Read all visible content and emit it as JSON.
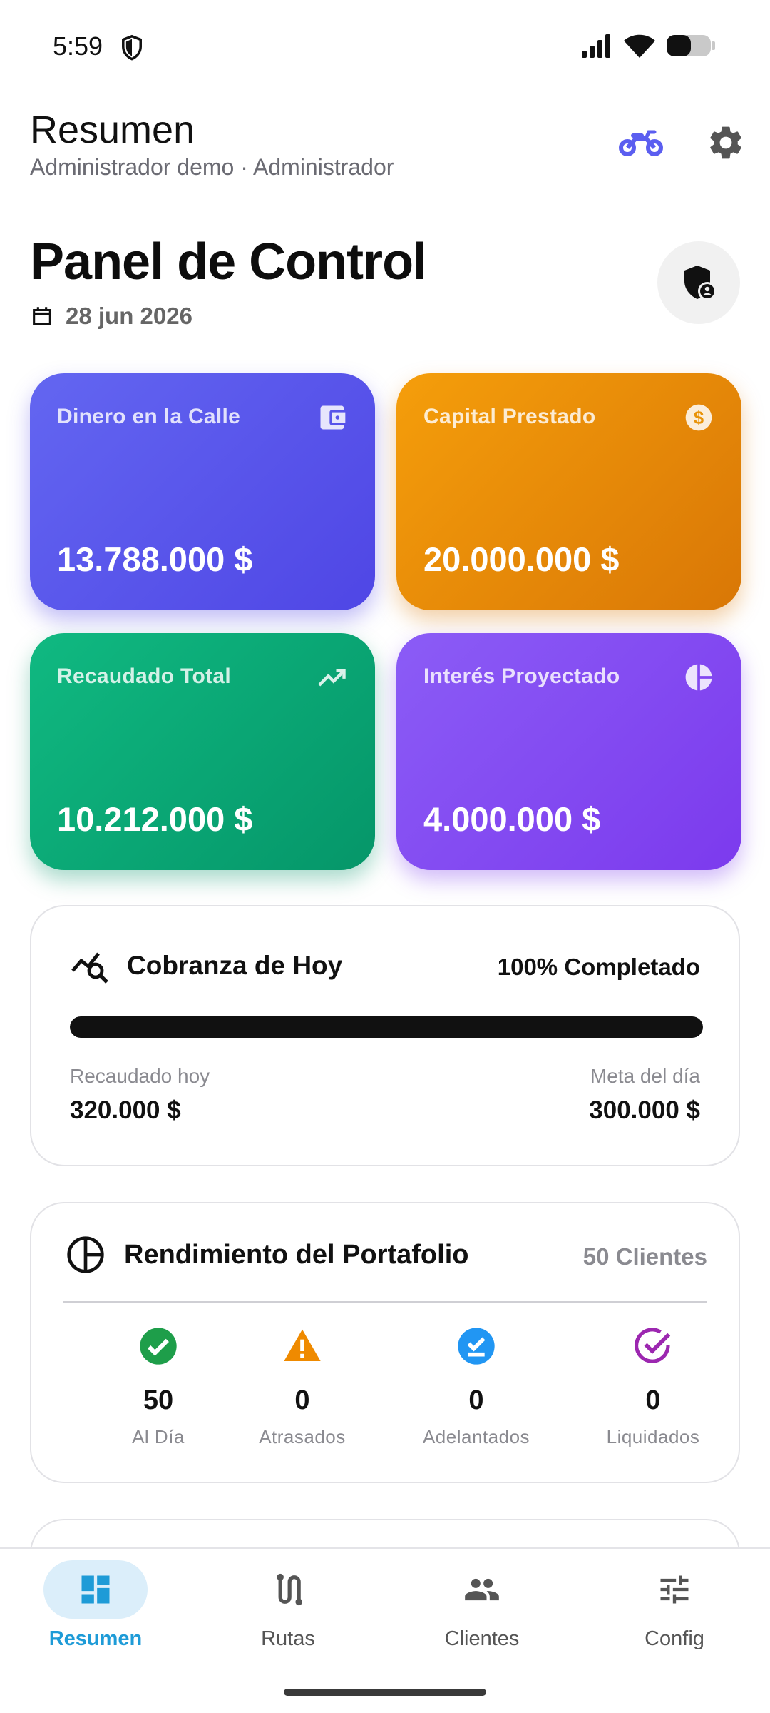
{
  "status_bar": {
    "time": "5:59"
  },
  "header": {
    "title": "Resumen",
    "subtitle": "Administrador demo · Administrador"
  },
  "panel": {
    "title": "Panel de Control",
    "date": "28 jun 2026"
  },
  "stats": [
    {
      "label": "Dinero en la Calle",
      "value": "13.788.000 $",
      "icon": "wallet-icon",
      "color": "#5b5ef0"
    },
    {
      "label": "Capital Prestado",
      "value": "20.000.000 $",
      "icon": "dollar-icon",
      "color": "#f08c08"
    },
    {
      "label": "Recaudado Total",
      "value": "10.212.000 $",
      "icon": "trending-up-icon",
      "color": "#10b07a"
    },
    {
      "label": "Interés Proyectado",
      "value": "4.000.000 $",
      "icon": "pie-chart-icon",
      "color": "#8350f2"
    }
  ],
  "cobranza": {
    "title": "Cobranza de Hoy",
    "completed_text": "100% Completado",
    "progress": 1.0,
    "collected_label": "Recaudado hoy",
    "collected_value": "320.000 $",
    "goal_label": "Meta del día",
    "goal_value": "300.000 $"
  },
  "portafolio": {
    "title": "Rendimiento del Portafolio",
    "clients": "50 Clientes",
    "items": [
      {
        "value": "50",
        "label": "Al Día",
        "icon": "check-circle-icon",
        "color": "#1e9e4a"
      },
      {
        "value": "0",
        "label": "Atrasados",
        "icon": "warning-icon",
        "color": "#ef8a00"
      },
      {
        "value": "0",
        "label": "Adelantados",
        "icon": "check-badge-icon",
        "color": "#2196f3"
      },
      {
        "value": "0",
        "label": "Liquidados",
        "icon": "check-outline-icon",
        "color": "#9c27b0"
      }
    ]
  },
  "nav": {
    "items": [
      {
        "label": "Resumen",
        "icon": "dashboard-icon",
        "active": true
      },
      {
        "label": "Rutas",
        "icon": "route-icon",
        "active": false
      },
      {
        "label": "Clientes",
        "icon": "people-icon",
        "active": false
      },
      {
        "label": "Config",
        "icon": "sliders-icon",
        "active": false
      }
    ]
  },
  "colors": {
    "accent": "#1e9bd7",
    "moto": "#5b5ef0"
  }
}
